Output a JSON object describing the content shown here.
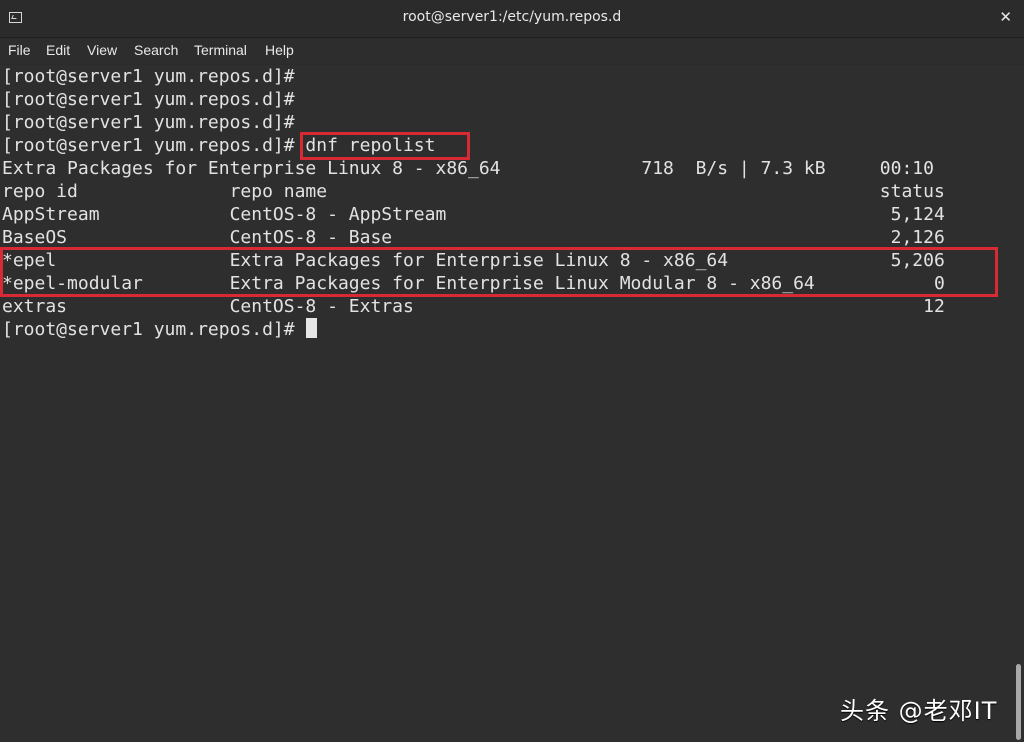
{
  "window": {
    "title": "root@server1:/etc/yum.repos.d"
  },
  "menu": [
    "File",
    "Edit",
    "View",
    "Search",
    "Terminal",
    "Help"
  ],
  "terminal": {
    "lines": [
      "[root@server1 yum.repos.d]#",
      "[root@server1 yum.repos.d]#",
      "[root@server1 yum.repos.d]#",
      "[root@server1 yum.repos.d]# dnf repolist",
      "Extra Packages for Enterprise Linux 8 - x86_64             718  B/s | 7.3 kB     00:10",
      "repo id              repo name                                                   status",
      "AppStream            CentOS-8 - AppStream                                         5,124",
      "BaseOS               CentOS-8 - Base                                              2,126",
      "*epel                Extra Packages for Enterprise Linux 8 - x86_64               5,206",
      "*epel-modular        Extra Packages for Enterprise Linux Modular 8 - x86_64           0",
      "extras               CentOS-8 - Extras                                               12",
      "[root@server1 yum.repos.d]# "
    ]
  },
  "watermark": "头条 @老邓IT",
  "colors": {
    "highlight_border": "#d72a35",
    "terminal_bg": "#2e2e2e",
    "text": "#e2e2e2"
  }
}
